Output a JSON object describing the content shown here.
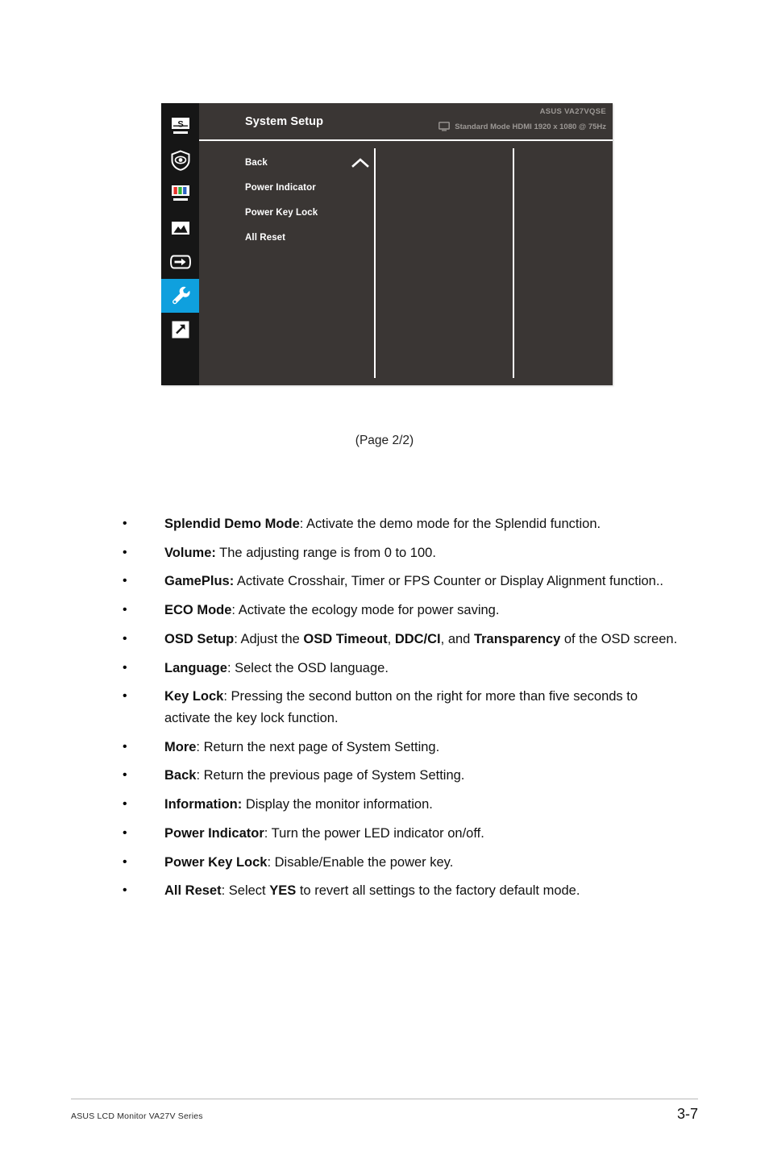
{
  "osd": {
    "title": "System Setup",
    "model": "ASUS  VA27VQSE",
    "mode": "Standard Mode HDMI 1920 x 1080 @ 75Hz",
    "accent_color": "#0fa0de",
    "panel_bg": "#3a3634",
    "sidebar_bg": "#161616",
    "sidebar_icons": [
      {
        "name": "splendid-icon",
        "label": "Splendid"
      },
      {
        "name": "eyecare-shield-icon",
        "label": "EyeCare"
      },
      {
        "name": "color-bars-icon",
        "label": "Color"
      },
      {
        "name": "image-icon",
        "label": "Image"
      },
      {
        "name": "input-select-icon",
        "label": "Input Select"
      },
      {
        "name": "wrench-icon",
        "label": "System Setup",
        "active": true
      },
      {
        "name": "shortcut-arrow-icon",
        "label": "Shortcut"
      }
    ],
    "menu_items": [
      {
        "label": "Back",
        "chevron": "chevron-up-icon"
      },
      {
        "label": "Power Indicator",
        "chevron": ""
      },
      {
        "label": "Power Key Lock",
        "chevron": ""
      },
      {
        "label": "All Reset",
        "chevron": ""
      }
    ]
  },
  "caption": "(Page 2/2)",
  "bullets": [
    {
      "dot": "•",
      "term": "Splendid Demo Mode",
      "sep": ": ",
      "rest": "Activate the demo mode for the Splendid function."
    },
    {
      "dot": "•",
      "term": "Volume:",
      "sep": " ",
      "rest": "The adjusting range is from 0 to 100."
    },
    {
      "dot": "•",
      "term": "GamePlus:",
      "sep": " ",
      "rest": "Activate Crosshair, Timer or FPS Counter or Display Alignment function.."
    },
    {
      "dot": "•",
      "term": "ECO Mode",
      "sep": ": ",
      "rest": "Activate the ecology mode for power saving."
    },
    {
      "dot": "•",
      "term": "OSD Setup",
      "sep": ": ",
      "rest": "Adjust the ",
      "b1": "OSD Timeout",
      "mid1": ", ",
      "b2": "DDC/CI",
      "mid2": ", and ",
      "b3": "Transparency",
      "tail": " of the OSD screen."
    },
    {
      "dot": "•",
      "term": "Language",
      "sep": ": ",
      "rest": "Select the OSD language."
    },
    {
      "dot": "•",
      "term": "Key Lock",
      "sep": ": ",
      "rest": "Pressing the second button on the right for more than five seconds to activate the key lock function."
    },
    {
      "dot": "•",
      "term": "More",
      "sep": ": ",
      "rest": "Return the next page of System Setting."
    },
    {
      "dot": "•",
      "term": "Back",
      "sep": ": ",
      "rest": "Return the previous page of System Setting."
    },
    {
      "dot": "•",
      "term": "Information:",
      "sep": " ",
      "rest": "Display the monitor information."
    },
    {
      "dot": "•",
      "term": "Power Indicator",
      "sep": ": ",
      "rest": "Turn the power LED indicator on/off."
    },
    {
      "dot": "•",
      "term": "Power Key Lock",
      "sep": ": ",
      "rest": "Disable/Enable the power key."
    },
    {
      "dot": "•",
      "term": "All Reset",
      "sep": ": ",
      "rest": "Select ",
      "b1": "YES",
      "tail": " to revert all settings to the factory default mode."
    }
  ],
  "footer": {
    "left": "ASUS LCD Monitor VA27V Series",
    "right": "3-7"
  }
}
